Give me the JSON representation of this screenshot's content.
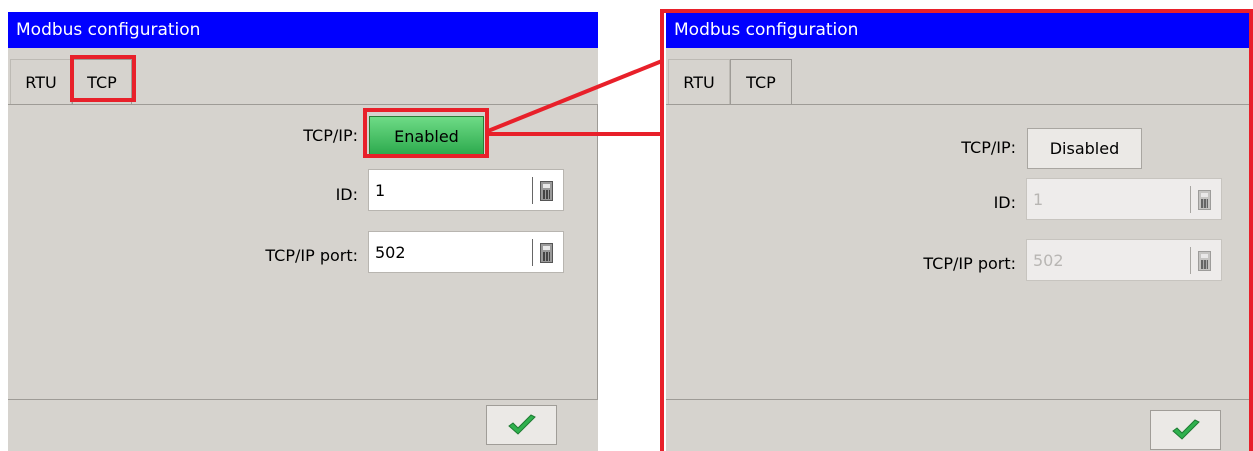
{
  "colors": {
    "titlebar": "#0000ff",
    "panel_bg": "#d6d3ce",
    "enabled_green": "#3dc05e",
    "highlight_red": "#e8202a",
    "check_green": "#2fb14e"
  },
  "left_window": {
    "title": "Modbus configuration",
    "tabs": [
      {
        "label": "RTU"
      },
      {
        "label": "TCP"
      }
    ],
    "active_tab": "TCP",
    "tcpip_label": "TCP/IP:",
    "tcpip_state": "Enabled",
    "id_label": "ID:",
    "id_value": "1",
    "port_label": "TCP/IP port:",
    "port_value": "502",
    "ok_icon": "checkmark-icon",
    "field_icon": "calculator-icon"
  },
  "right_window": {
    "title": "Modbus configuration",
    "tabs": [
      {
        "label": "RTU"
      },
      {
        "label": "TCP"
      }
    ],
    "active_tab": "TCP",
    "tcpip_label": "TCP/IP:",
    "tcpip_state": "Disabled",
    "id_label": "ID:",
    "id_value": "1",
    "port_label": "TCP/IP port:",
    "port_value": "502",
    "ok_icon": "checkmark-icon",
    "field_icon": "calculator-icon"
  }
}
